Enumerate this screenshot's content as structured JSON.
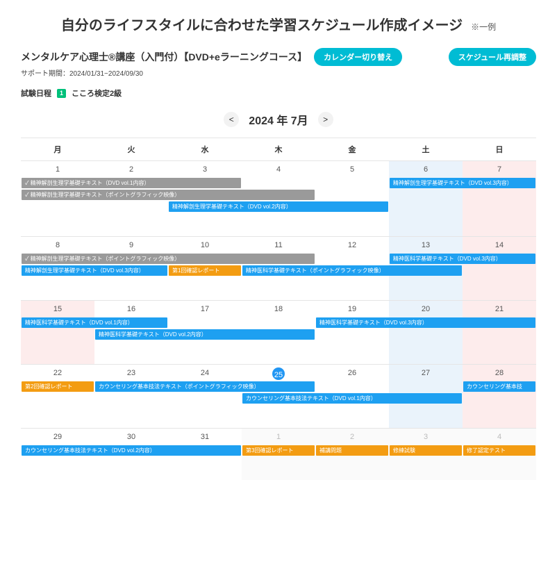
{
  "page_title": "自分のライフスタイルに合わせた学習スケジュール作成イメージ",
  "page_title_note": "※一例",
  "course_title": "メンタルケア心理士®講座（入門付）【DVD+eラーニングコース】",
  "btn_calendar_switch": "カレンダー切り替え",
  "btn_reschedule": "スケジュール再調整",
  "support_label": "サポート期間：2024/01/31~2024/09/30",
  "exam_label": "試験日程",
  "exam_badge": "1",
  "exam_name": "こころ検定2級",
  "month_label": "2024 年 7月",
  "dow": [
    "月",
    "火",
    "水",
    "木",
    "金",
    "土",
    "日"
  ],
  "weeks": [
    {
      "days": [
        {
          "n": "1"
        },
        {
          "n": "2"
        },
        {
          "n": "3"
        },
        {
          "n": "4"
        },
        {
          "n": "5"
        },
        {
          "n": "6",
          "cls": "sat-bg"
        },
        {
          "n": "7",
          "cls": "sun-bg"
        }
      ],
      "bars": [
        {
          "row": 0,
          "start": 0,
          "span": 3,
          "cls": "gray check",
          "text": "精神解剖生理学基礎テキスト（DVD vol.1内容）"
        },
        {
          "row": 0,
          "start": 5,
          "span": 2,
          "cls": "blue",
          "text": "精神解剖生理学基礎テキスト（DVD vol.3内容）"
        },
        {
          "row": 1,
          "start": 0,
          "span": 4,
          "cls": "gray check",
          "text": "精神解剖生理学基礎テキスト（ポイントグラフィック映像）"
        },
        {
          "row": 2,
          "start": 2,
          "span": 3,
          "cls": "blue",
          "text": "精神解剖生理学基礎テキスト（DVD vol.2内容）"
        }
      ]
    },
    {
      "days": [
        {
          "n": "8"
        },
        {
          "n": "9"
        },
        {
          "n": "10"
        },
        {
          "n": "11"
        },
        {
          "n": "12"
        },
        {
          "n": "13",
          "cls": "sat-bg"
        },
        {
          "n": "14",
          "cls": "sun-bg"
        }
      ],
      "bars": [
        {
          "row": 0,
          "start": 0,
          "span": 4,
          "cls": "gray check",
          "text": "精神解剖生理学基礎テキスト（ポイントグラフィック映像）"
        },
        {
          "row": 0,
          "start": 5,
          "span": 2,
          "cls": "blue",
          "text": "精神医科学基礎テキスト（DVD vol.3内容）"
        },
        {
          "row": 1,
          "start": 0,
          "span": 2,
          "cls": "blue",
          "text": "精神解剖生理学基礎テキスト（DVD vol.3内容）"
        },
        {
          "row": 1,
          "start": 2,
          "span": 1,
          "cls": "orange",
          "text": "第1回確認レポート"
        },
        {
          "row": 1,
          "start": 3,
          "span": 3,
          "cls": "blue",
          "text": "精神医科学基礎テキスト（ポイントグラフィック映像）"
        }
      ]
    },
    {
      "days": [
        {
          "n": "15",
          "cls": "sun-bg"
        },
        {
          "n": "16"
        },
        {
          "n": "17"
        },
        {
          "n": "18"
        },
        {
          "n": "19"
        },
        {
          "n": "20",
          "cls": "sat-bg"
        },
        {
          "n": "21",
          "cls": "sun-bg"
        }
      ],
      "bars": [
        {
          "row": 0,
          "start": 0,
          "span": 2,
          "cls": "blue",
          "text": "精神医科学基礎テキスト（DVD vol.1内容）"
        },
        {
          "row": 0,
          "start": 4,
          "span": 3,
          "cls": "blue",
          "text": "精神医科学基礎テキスト（DVD vol.3内容）"
        },
        {
          "row": 1,
          "start": 1,
          "span": 3,
          "cls": "blue",
          "text": "精神医科学基礎テキスト（DVD vol.2内容）"
        }
      ]
    },
    {
      "days": [
        {
          "n": "22"
        },
        {
          "n": "23"
        },
        {
          "n": "24"
        },
        {
          "n": "25",
          "today": true
        },
        {
          "n": "26"
        },
        {
          "n": "27",
          "cls": "sat-bg"
        },
        {
          "n": "28",
          "cls": "sun-bg"
        }
      ],
      "bars": [
        {
          "row": 0,
          "start": 0,
          "span": 1,
          "cls": "orange",
          "text": "第2回確認レポート"
        },
        {
          "row": 0,
          "start": 1,
          "span": 3,
          "cls": "blue",
          "text": "カウンセリング基本技法テキスト（ポイントグラフィック映像）"
        },
        {
          "row": 0,
          "start": 6,
          "span": 1,
          "cls": "blue",
          "text": "カウンセリング基本技"
        },
        {
          "row": 1,
          "start": 3,
          "span": 3,
          "cls": "blue",
          "text": "カウンセリング基本技法テキスト（DVD vol.1内容）"
        }
      ]
    },
    {
      "days": [
        {
          "n": "29"
        },
        {
          "n": "30"
        },
        {
          "n": "31"
        },
        {
          "n": "1",
          "cls": "other-bg",
          "other": true
        },
        {
          "n": "2",
          "cls": "other-bg",
          "other": true
        },
        {
          "n": "3",
          "cls": "other-bg",
          "other": true
        },
        {
          "n": "4",
          "cls": "other-bg",
          "other": true
        }
      ],
      "bars": [
        {
          "row": 0,
          "start": 0,
          "span": 3,
          "cls": "blue",
          "text": "カウンセリング基本技法テキスト（DVD vol.2内容）"
        },
        {
          "row": 0,
          "start": 3,
          "span": 1,
          "cls": "orange",
          "text": "第3回確認レポート"
        },
        {
          "row": 0,
          "start": 4,
          "span": 1,
          "cls": "orange",
          "text": "補講問題"
        },
        {
          "row": 0,
          "start": 5,
          "span": 1,
          "cls": "orange",
          "text": "修練試験"
        },
        {
          "row": 0,
          "start": 6,
          "span": 1,
          "cls": "orange",
          "text": "修了認定テスト"
        }
      ]
    }
  ]
}
